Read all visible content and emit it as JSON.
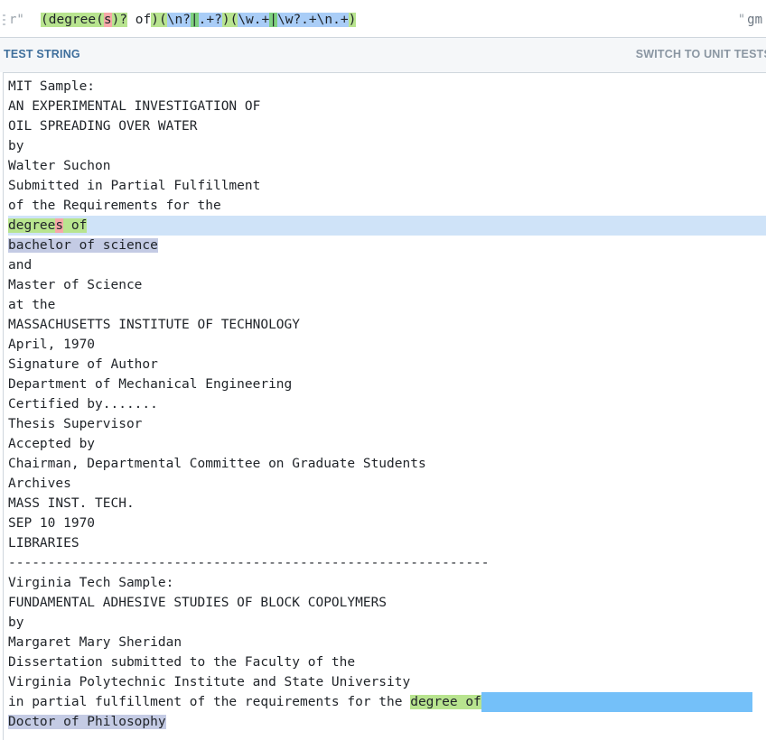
{
  "regex_bar": {
    "open_delim": "r\"",
    "close_delim": "\"",
    "flags": "gm",
    "pattern_parts": [
      {
        "text": "(degree(",
        "cls": "rx-g1"
      },
      {
        "text": "s",
        "cls": "rx-g2"
      },
      {
        "text": ")?",
        "cls": "rx-g1"
      },
      {
        "text": " of",
        "cls": ""
      },
      {
        "text": ")(",
        "cls": "rx-paren"
      },
      {
        "text": "\\n?",
        "cls": "rx-g3"
      },
      {
        "text": "|",
        "cls": "rx-alt"
      },
      {
        "text": ".+?",
        "cls": "rx-g3"
      },
      {
        "text": ")(",
        "cls": "rx-paren"
      },
      {
        "text": "\\w.+",
        "cls": "rx-g3"
      },
      {
        "text": "|",
        "cls": "rx-alt"
      },
      {
        "text": "\\w?.+\\n.+",
        "cls": "rx-g3"
      },
      {
        "text": ")",
        "cls": "rx-paren"
      }
    ]
  },
  "section": {
    "title": "TEST STRING",
    "switch_label": "SWITCH TO UNIT TESTS"
  },
  "test_string": {
    "lines": [
      "MIT Sample:",
      "AN EXPERIMENTAL INVESTIGATION OF",
      "OIL SPREADING OVER WATER",
      "by",
      "Walter Suchon",
      "Submitted in Partial Fulfillment",
      "of the Requirements for the",
      "degrees of",
      "bachelor of science",
      "and",
      "Master of Science",
      "at the",
      "MASSACHUSETTS INSTITUTE OF TECHNOLOGY",
      "April, 1970",
      "Signature of Author",
      "Department of Mechanical Engineering",
      "Certified by.......",
      "Thesis Supervisor",
      "Accepted by",
      "Chairman, Departmental Committee on Graduate Students",
      "Archives",
      "MASS INST. TECH.",
      "SEP 10 1970",
      "LIBRARIES",
      "-------------------------------------------------------------",
      "Virginia Tech Sample:",
      "FUNDAMENTAL ADHESIVE STUDIES OF BLOCK COPOLYMERS",
      "by",
      "Margaret Mary Sheridan",
      "Dissertation submitted to the Faculty of the",
      "Virginia Polytechnic Institute and State University",
      "in partial fulfillment of the requirements for the degree of",
      "Doctor of Philosophy"
    ]
  },
  "colors": {
    "group1_match": "#b8e48f",
    "group2_match": "#f6a8a8",
    "group3_match": "#c4cbe4",
    "line_match": "#cfe3f8",
    "newline_match": "#74c0f9"
  }
}
